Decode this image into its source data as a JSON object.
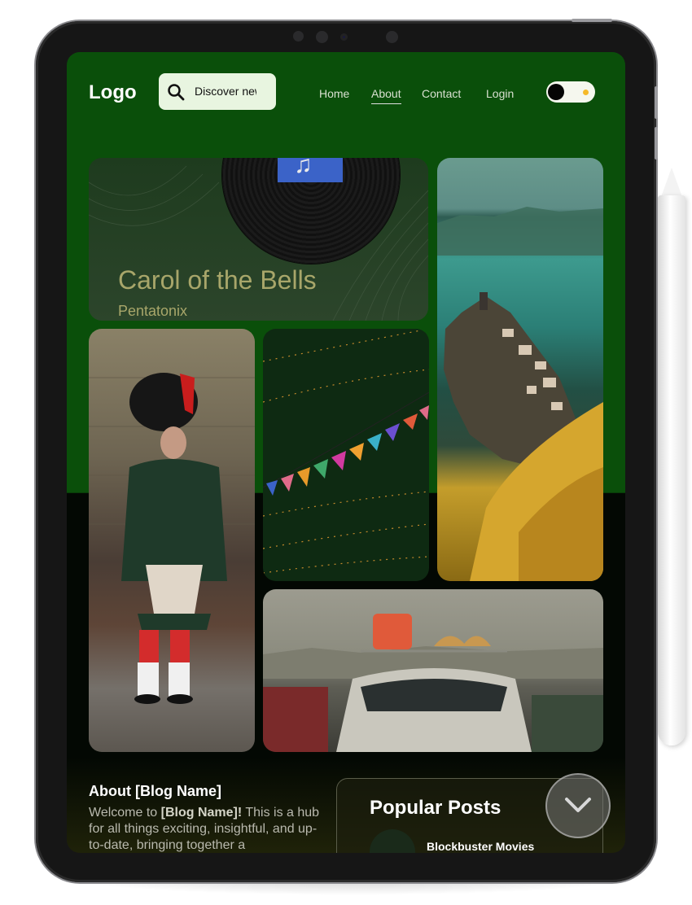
{
  "nav": {
    "logo": "Logo",
    "search_placeholder": "Discover new",
    "links": [
      "Home",
      "About",
      "Contact",
      "Login"
    ],
    "active_link": "About"
  },
  "music_card": {
    "title": "Carol of the Bells",
    "artist": "Pentatonix"
  },
  "about": {
    "title": "About [Blog Name]",
    "text_intro": "Welcome to ",
    "text_blog": "[Blog Name]!",
    "text_rest": " This is a hub for all things exciting, insightful, and up-to-date, bringing together a"
  },
  "popular": {
    "title": "Popular Posts",
    "first_post": "Blockbuster Movies"
  },
  "colors": {
    "header_green": "#0a4f0a",
    "accent_sun": "#f5b928",
    "song_text": "#a8a66a"
  },
  "icons": {
    "search": "search-icon",
    "theme_toggle": "theme-toggle",
    "scroll": "chevron-down-icon"
  }
}
